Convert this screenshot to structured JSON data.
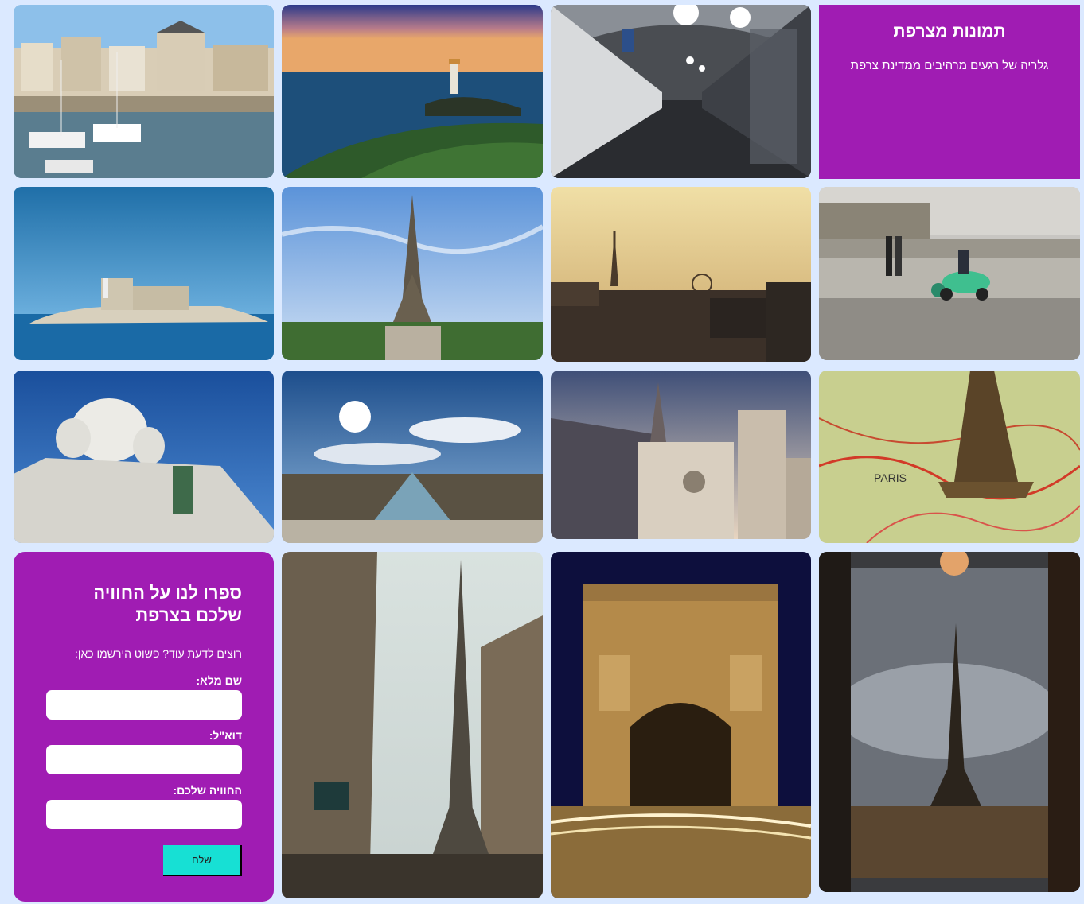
{
  "gallery": {
    "title": "תמונות מצרפת",
    "subtitle": "גלריה של רגעים מרהיבים ממדינת צרפת"
  },
  "photos": [
    {
      "name": "harbor-town-photo"
    },
    {
      "name": "lighthouse-coast-photo"
    },
    {
      "name": "metro-station-photo"
    },
    {
      "name": "island-fortress-photo"
    },
    {
      "name": "eiffel-tower-day-photo"
    },
    {
      "name": "paris-rooftops-sunset-photo"
    },
    {
      "name": "paris-street-scooter-photo"
    },
    {
      "name": "sacre-coeur-photo"
    },
    {
      "name": "louvre-pyramid-photo"
    },
    {
      "name": "gothic-cathedral-photo"
    },
    {
      "name": "eiffel-model-map-photo"
    },
    {
      "name": "eiffel-street-view-photo"
    },
    {
      "name": "arc-de-triomphe-night-photo"
    },
    {
      "name": "eiffel-through-window-photo"
    }
  ],
  "form": {
    "title": "ספרו לנו על החוויה שלכם בצרפת",
    "lead": "רוצים לדעת עוד? פשוט הירשמו כאן:",
    "name_label": "שם מלא:",
    "email_label": "דוא\"ל:",
    "experience_label": "החוויה שלכם:",
    "name_value": "",
    "email_value": "",
    "experience_value": "",
    "submit_label": "שלח"
  },
  "colors": {
    "page_background": "#dbe9ff",
    "panel_purple": "#a01cb3",
    "button_cyan": "#17e0d4"
  }
}
